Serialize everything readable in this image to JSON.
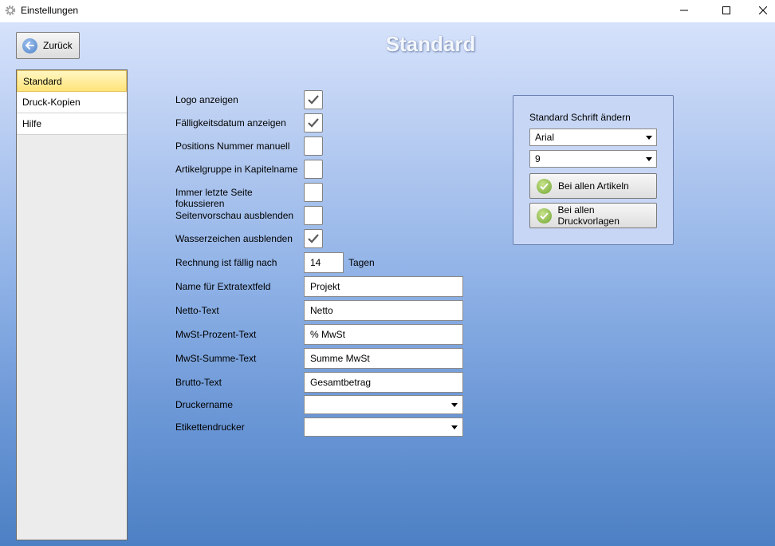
{
  "window": {
    "title": "Einstellungen",
    "icons": {
      "app": "gear-icon",
      "minimize": "minimize-icon",
      "maximize": "maximize-icon",
      "close": "close-icon"
    }
  },
  "header": {
    "back_label": "Zurück",
    "page_title": "Standard"
  },
  "sidebar": {
    "items": [
      {
        "label": "Standard",
        "active": true
      },
      {
        "label": "Druck-Kopien",
        "active": false
      },
      {
        "label": "Hilfe",
        "active": false
      }
    ]
  },
  "form": {
    "checkboxes": [
      {
        "label": "Logo anzeigen",
        "checked": true
      },
      {
        "label": "Fälligkeitsdatum anzeigen",
        "checked": true
      },
      {
        "label": "Positions Nummer manuell",
        "checked": false
      },
      {
        "label": "Artikelgruppe in Kapitelname",
        "checked": false
      },
      {
        "label": "Immer letzte Seite fokussieren",
        "checked": false
      },
      {
        "label": "Seitenvorschau ausblenden",
        "checked": false
      },
      {
        "label": "Wasserzeichen ausblenden",
        "checked": true
      }
    ],
    "due": {
      "label": "Rechnung ist fällig nach",
      "value": "14",
      "unit": "Tagen"
    },
    "text_fields": [
      {
        "label": "Name für Extratextfeld",
        "value": "Projekt"
      },
      {
        "label": "Netto-Text",
        "value": "Netto"
      },
      {
        "label": "MwSt-Prozent-Text",
        "value": "% MwSt"
      },
      {
        "label": "MwSt-Summe-Text",
        "value": "Summe MwSt"
      },
      {
        "label": "Brutto-Text",
        "value": "Gesamtbetrag"
      }
    ],
    "combos": [
      {
        "label": "Druckername",
        "value": ""
      },
      {
        "label": "Etikettendrucker",
        "value": ""
      }
    ]
  },
  "font_panel": {
    "title": "Standard Schrift ändern",
    "font_value": "Arial",
    "size_value": "9",
    "apply_articles_label": "Bei allen Artikeln",
    "apply_templates_label": "Bei allen Druckvorlagen"
  },
  "colors": {
    "accent_active": "#ffe47a",
    "gradient_top": "#d6e2fb",
    "gradient_bottom": "#4c80c4"
  }
}
